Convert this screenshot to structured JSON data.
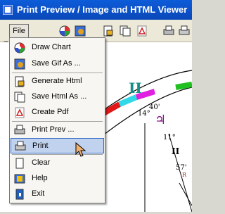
{
  "window": {
    "title": "Print Preview / Image and HTML Viewer"
  },
  "menubar": {
    "file_label": "File",
    "file_mnemonic_hint": "C"
  },
  "file_menu": {
    "items": [
      {
        "label": "Draw Chart",
        "icon": "draw-chart-icon"
      },
      {
        "label": "Save Gif As ...",
        "icon": "save-gif-icon"
      },
      {
        "label": "Generate Html",
        "icon": "generate-html-icon"
      },
      {
        "label": "Save Html As ...",
        "icon": "save-html-icon"
      },
      {
        "label": "Create Pdf",
        "icon": "pdf-icon"
      },
      {
        "label": "Print Prev ...",
        "icon": "print-preview-icon"
      },
      {
        "label": "Print",
        "icon": "printer-icon",
        "highlighted": true
      },
      {
        "label": "Clear",
        "icon": "clear-icon"
      },
      {
        "label": "Help",
        "icon": "help-icon"
      },
      {
        "label": "Exit",
        "icon": "exit-icon"
      }
    ]
  },
  "chart_fragment": {
    "sign_glyph_top": "II",
    "sign_glyph_right": "II",
    "degree_label_1": "14°",
    "degree_label_1_min": "40'",
    "degree_label_2": "11°",
    "degree_label_3": "57'",
    "planet_glyph": "♃",
    "r_label": "R"
  },
  "colors": {
    "titlebar": "#0d5cd9",
    "menu_highlight": "#c1d2ee",
    "menu_highlight_border": "#316ac5",
    "sign_glyph": "#168f86",
    "planet_glyph": "#8a1a8a"
  }
}
